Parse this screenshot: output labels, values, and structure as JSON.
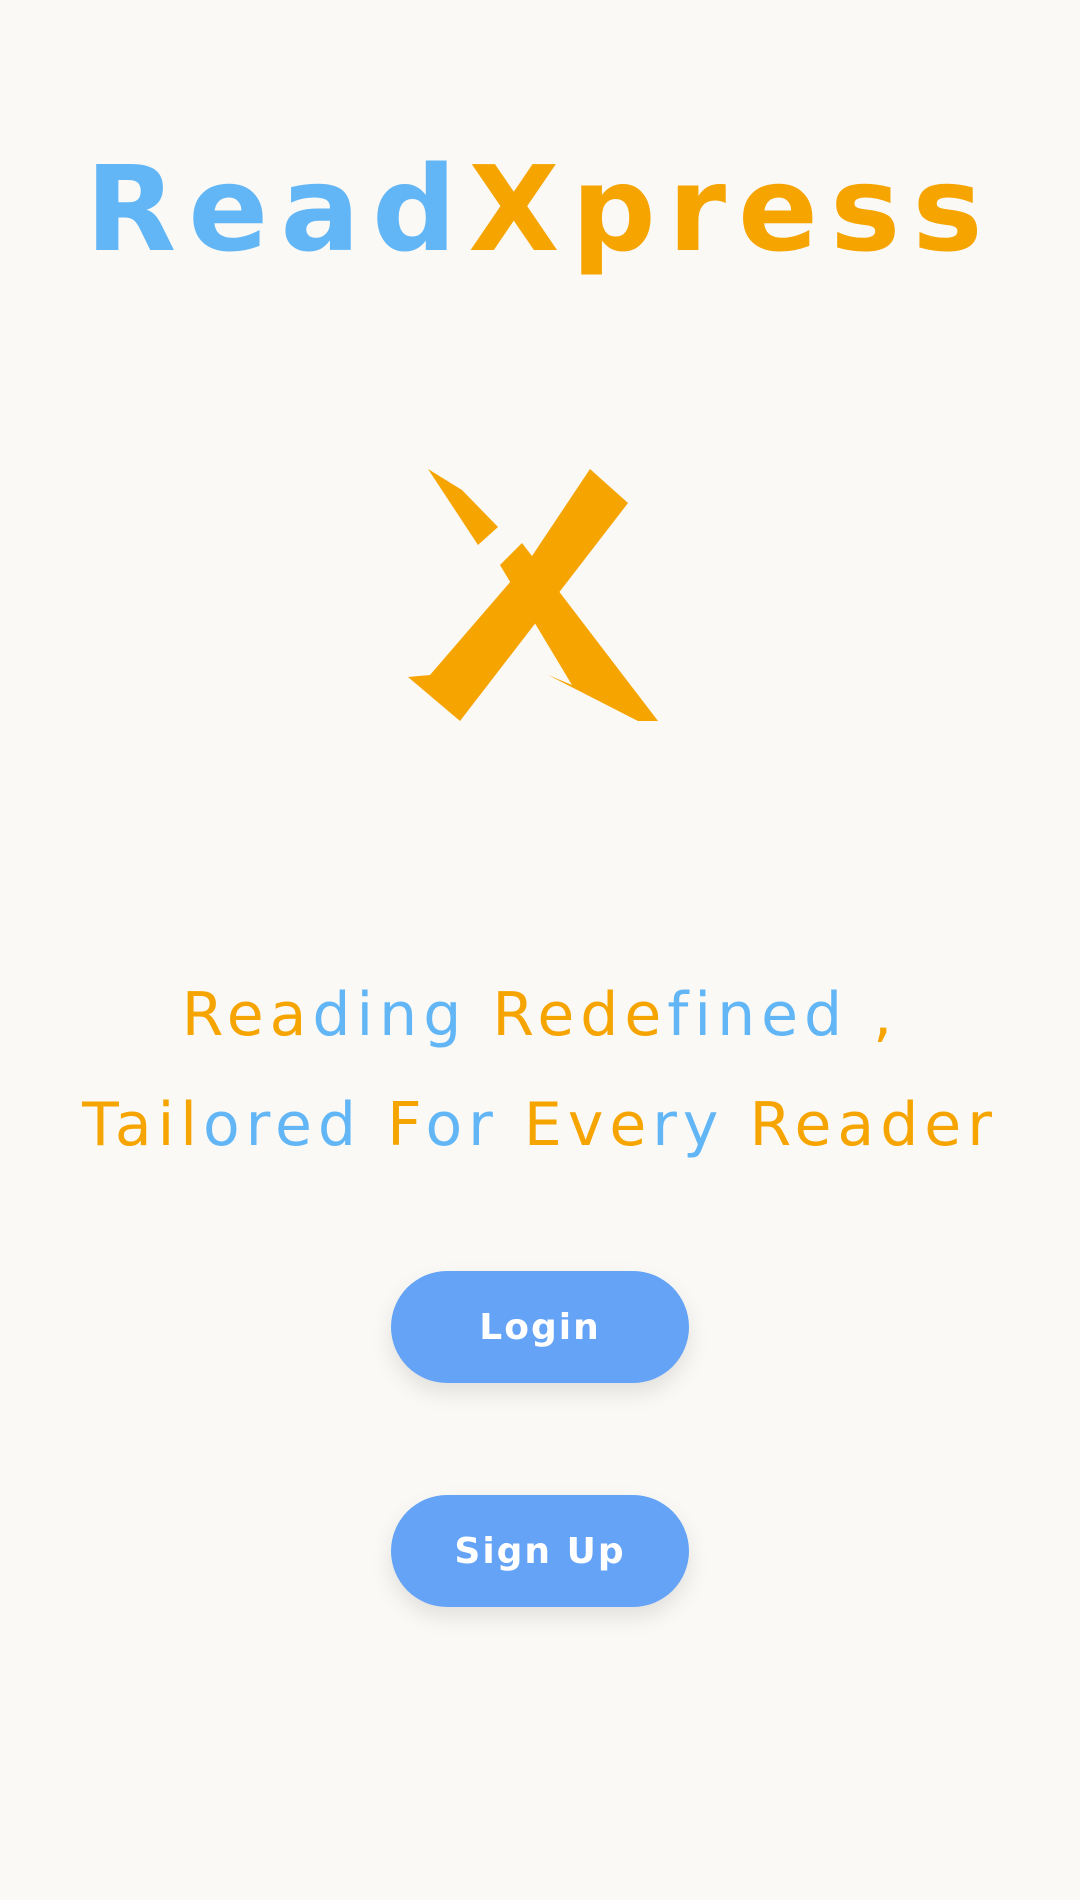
{
  "brand": {
    "part_a": "Read",
    "part_b": "Xpress"
  },
  "logo": {
    "icon": "x-logo-icon",
    "color": "#f6a400"
  },
  "tagline": {
    "line1_a": "Rea",
    "line1_b": "ding",
    "line1_c": " Rede",
    "line1_d": "fined",
    "line1_e": " ,",
    "line2_a": "Tail",
    "line2_b": "ored",
    "line2_c": " F",
    "line2_d": "or",
    "line2_e": " Eve",
    "line2_f": "ry",
    "line2_g": " Reader"
  },
  "buttons": {
    "login": "Login",
    "signup": "Sign Up"
  },
  "colors": {
    "background": "#faf9f6",
    "blue": "#62b6f6",
    "orange": "#f6a400",
    "button": "#64a3f5"
  }
}
